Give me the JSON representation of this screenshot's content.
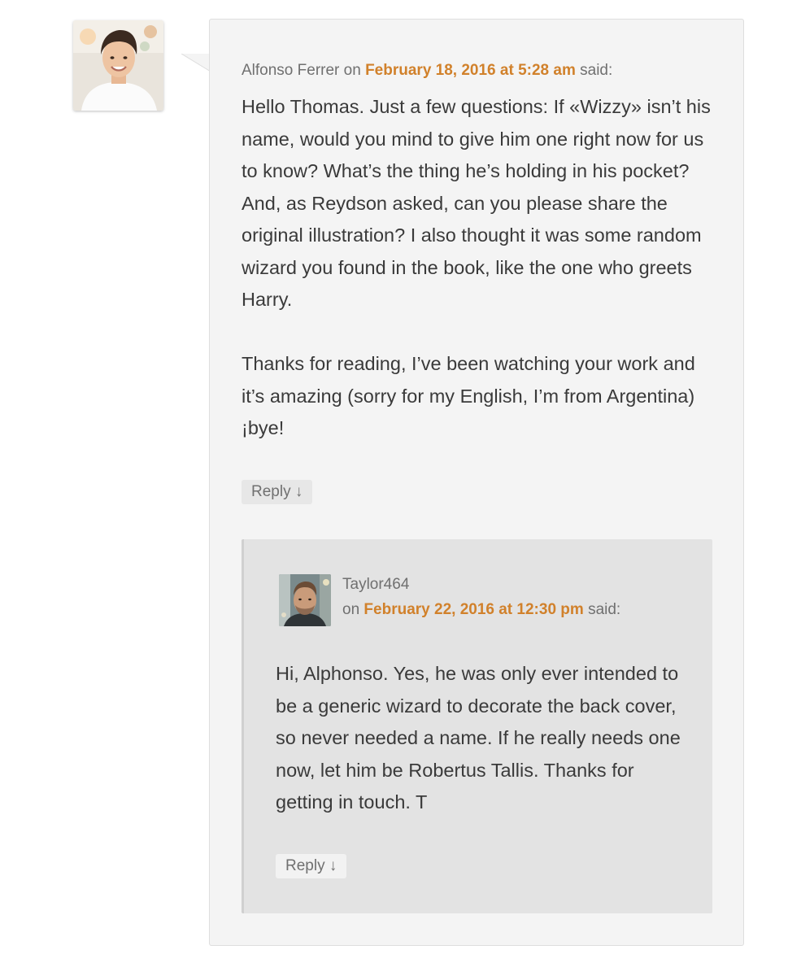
{
  "parent_comment": {
    "author": "Alfonso Ferrer",
    "on_word": "on",
    "date": "February 18, 2016 at 5:28 am",
    "said": "said:",
    "paragraphs": [
      "Hello Thomas. Just a few questions: If «Wizzy» isn’t his name, would you mind to give him one right now for us to know? What’s the thing he’s holding in his pocket? And, as Reydson asked, can you please share the original illustration? I also thought it was some random wizard you found in the book, like the one who greets Harry.",
      "Thanks for reading, I’ve been watching your work and it’s amazing (sorry for my English, I’m from Argentina) ¡bye!"
    ],
    "reply_label": "Reply ↓"
  },
  "child_comment": {
    "author": "Taylor464",
    "on_word": "on",
    "date": "February 22, 2016 at 12:30 pm",
    "said": "said:",
    "text": "Hi, Alphonso. Yes, he was only ever intended to be a generic wizard to decorate the back cover, so never needed a name. If he really needs one now, let him be Robertus Tallis. Thanks for getting in touch. T",
    "reply_label": "Reply ↓"
  },
  "colors": {
    "link": "#d1812b",
    "meta_text": "#707070",
    "body_text": "#3a3a3a",
    "comment_bg": "#f4f4f4",
    "child_bg": "#e3e3e3"
  },
  "icons": {
    "parent_avatar": "avatar-photo-boy",
    "child_avatar": "avatar-photo-man"
  }
}
